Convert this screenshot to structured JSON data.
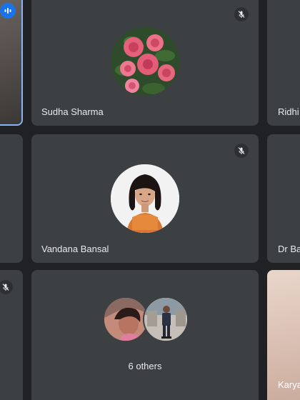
{
  "participants": [
    {
      "name": "Sudha Sharma",
      "muted": true,
      "avatar_icon": "roses-photo-avatar"
    },
    {
      "name": "Ridhi",
      "muted": false
    },
    {
      "name": "Vandana Bansal",
      "muted": true,
      "avatar_icon": "woman-photo-avatar"
    },
    {
      "name": "Dr Ba",
      "muted": false
    },
    {
      "name": "Karya",
      "muted": false
    }
  ],
  "others_tile": {
    "label": "6 others"
  },
  "active_speaker": {
    "speaking_icon": "audio-level-icon"
  },
  "colors": {
    "background": "#202124",
    "tile": "#3c4043",
    "active_border": "#8ab4f8",
    "speaking_badge": "#1a73e8",
    "text": "#e8eaed"
  }
}
